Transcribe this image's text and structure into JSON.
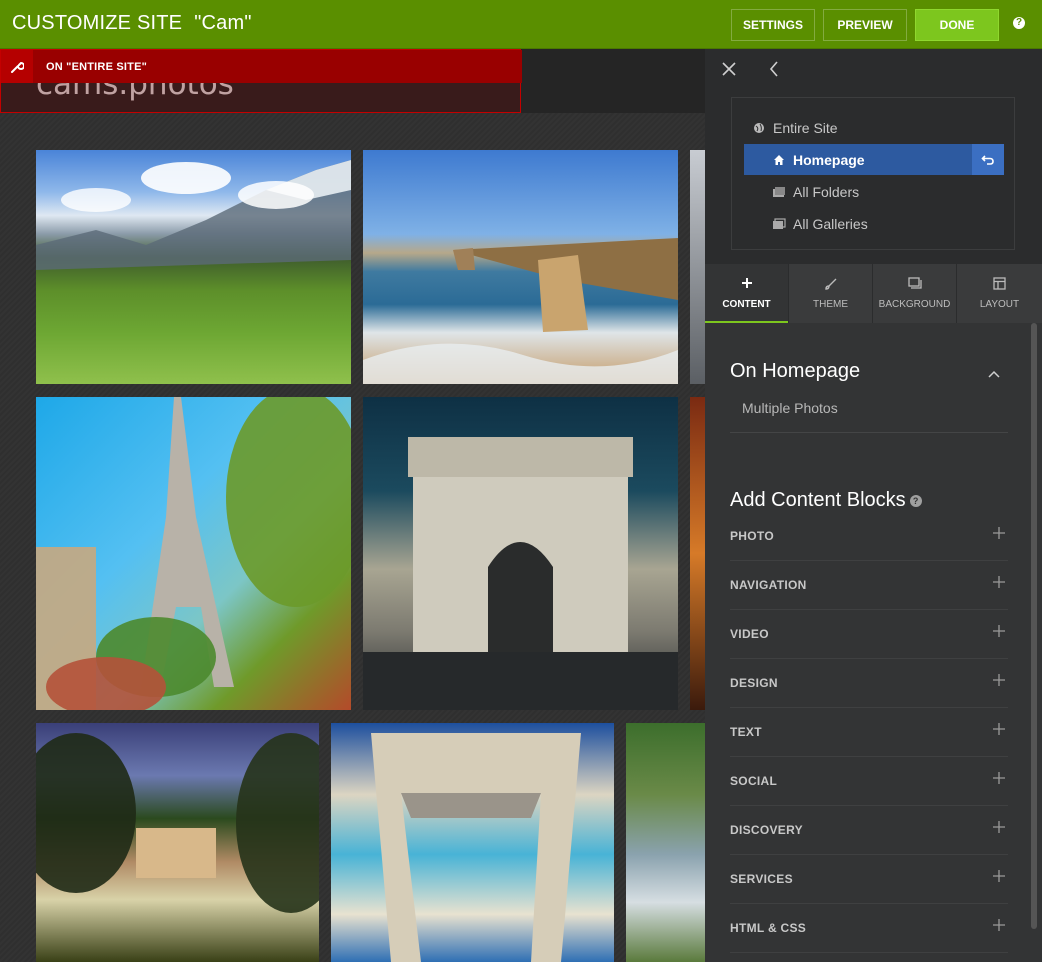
{
  "topbar": {
    "title": "CUSTOMIZE SITE",
    "site": "\"Cam\"",
    "settings": "SETTINGS",
    "preview": "PREVIEW",
    "done": "DONE",
    "help": "?"
  },
  "colors": {
    "topbar": "#5a8f00",
    "done_button": "#7dc61e",
    "selection": "#2d5aa0",
    "entire_site_bar": "#990000"
  },
  "canvas": {
    "site_name": "cams.photos",
    "scope_label": "ON \"ENTIRE SITE\""
  },
  "panel": {
    "tree": [
      {
        "label": "Entire Site",
        "icon": "globe-icon"
      },
      {
        "label": "Homepage",
        "icon": "home-icon",
        "selected": true
      },
      {
        "label": "All Folders",
        "icon": "folders-icon"
      },
      {
        "label": "All Galleries",
        "icon": "galleries-icon"
      }
    ],
    "tabs": [
      {
        "label": "CONTENT",
        "icon": "plus-icon",
        "active": true
      },
      {
        "label": "THEME",
        "icon": "brush-icon"
      },
      {
        "label": "BACKGROUND",
        "icon": "background-icon"
      },
      {
        "label": "LAYOUT",
        "icon": "layout-icon"
      }
    ],
    "on_homepage": "On Homepage",
    "multiple_photos": "Multiple Photos",
    "add_blocks": "Add Content Blocks",
    "help": "?",
    "blocks": [
      "PHOTO",
      "NAVIGATION",
      "VIDEO",
      "DESIGN",
      "TEXT",
      "SOCIAL",
      "DISCOVERY",
      "SERVICES",
      "HTML & CSS"
    ]
  }
}
